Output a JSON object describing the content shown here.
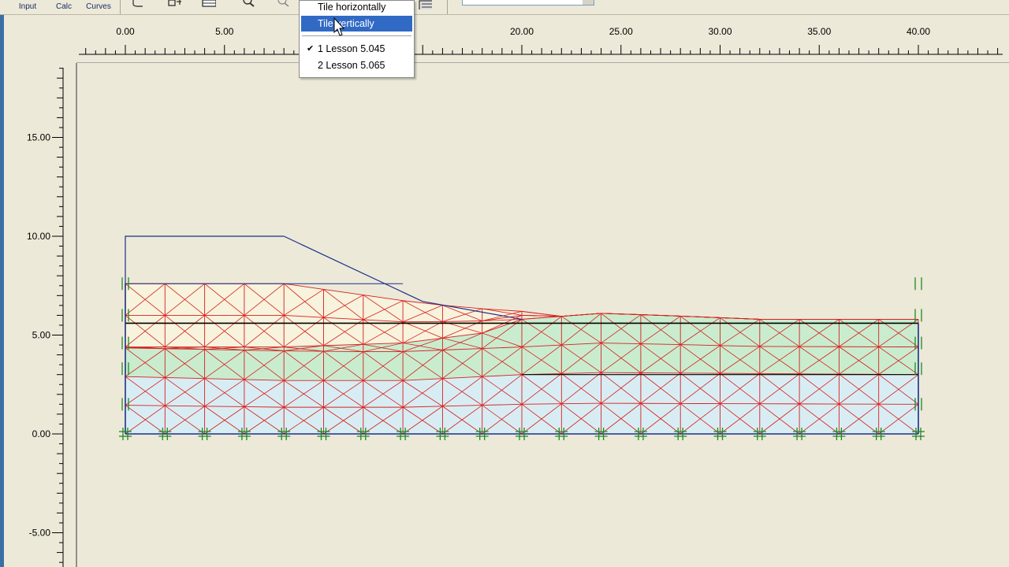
{
  "toolbar": {
    "buttons": [
      {
        "label": "Input"
      },
      {
        "label": "Calc"
      },
      {
        "label": "Curves"
      }
    ],
    "icons": [
      "stage-icon",
      "mesh-icon",
      "table-icon",
      "zoom-in-icon",
      "zoom-out-icon",
      "print-icon"
    ],
    "combo_value": ""
  },
  "window_menu": {
    "items": [
      {
        "label": "Tile horizontally",
        "highlighted": false,
        "checked": false
      },
      {
        "label": "Tile vertically",
        "highlighted": true,
        "checked": false
      },
      {
        "label": "1 Lesson 5.045",
        "highlighted": false,
        "checked": true
      },
      {
        "label": "2 Lesson 5.065",
        "highlighted": false,
        "checked": false
      }
    ]
  },
  "rulers": {
    "x_ticks": [
      "0.00",
      "5.00",
      "10.00",
      "15.00",
      "20.00",
      "25.00",
      "30.00",
      "35.00",
      "40.00"
    ],
    "y_ticks": [
      "15.00",
      "10.00",
      "5.00",
      "0.00",
      "-5.00"
    ]
  },
  "colors": {
    "background": "#ece9d8",
    "mesh_lines": "#d81e1e",
    "layer_top": "#f7f3dc",
    "layer_middle": "#c9ecce",
    "layer_bottom": "#d8edf3",
    "geometry": "#1b2f8a",
    "fixities": "#1e8a22",
    "menu_highlight": "#316ac5"
  },
  "model": {
    "x_range": [
      0,
      40
    ],
    "y_range": [
      0,
      10
    ],
    "layer_boundaries": {
      "top_surface": [
        [
          0,
          7.6
        ],
        [
          5,
          7.6
        ],
        [
          8,
          7.6
        ],
        [
          15,
          6.6
        ],
        [
          19.5,
          6.2
        ],
        [
          22,
          6.2
        ],
        [
          25,
          6.0
        ],
        [
          28,
          5.8
        ],
        [
          32.5,
          5.7
        ]
      ],
      "embankment_outline": [
        [
          0,
          10.0
        ],
        [
          8,
          10.0
        ],
        [
          15,
          6.7
        ],
        [
          20,
          5.8
        ]
      ],
      "clay_top": [
        [
          0,
          5.8
        ],
        [
          8,
          5.7
        ],
        [
          13,
          5.6
        ],
        [
          20,
          5.8
        ],
        [
          24,
          6.1
        ],
        [
          27,
          6.0
        ],
        [
          32,
          5.8
        ],
        [
          40,
          5.8
        ]
      ],
      "sand_top": [
        [
          0,
          4.4
        ],
        [
          8,
          4.4
        ],
        [
          14,
          4.6
        ],
        [
          18,
          5.1
        ],
        [
          20,
          5.8
        ]
      ],
      "base_top": [
        [
          0,
          2.9
        ],
        [
          8,
          2.7
        ],
        [
          14,
          2.7
        ],
        [
          20,
          3.0
        ],
        [
          24,
          3.1
        ],
        [
          40,
          3.0
        ]
      ],
      "bottom": [
        [
          0,
          0
        ],
        [
          40,
          0
        ]
      ]
    }
  }
}
